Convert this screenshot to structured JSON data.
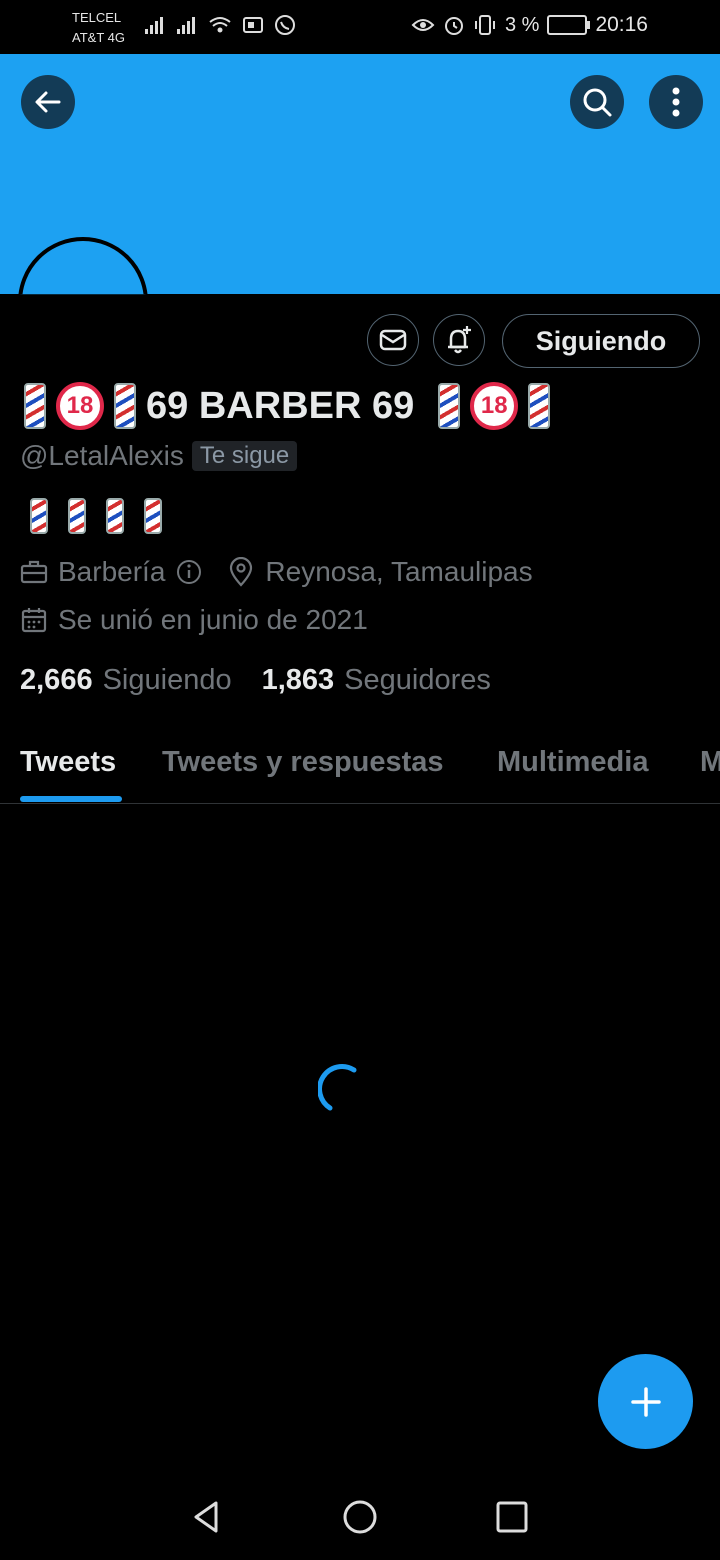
{
  "status_bar": {
    "carrier_1": "TELCEL",
    "carrier_2": "AT&T 4G",
    "battery": "3 %",
    "time": "20:16",
    "icons": [
      "signal-icon",
      "signal-icon",
      "wifi-icon",
      "data-icon",
      "whatsapp-icon",
      "eye-icon",
      "alarm-icon",
      "vibrate-icon",
      "battery-icon"
    ]
  },
  "header": {
    "back_icon": "back-arrow-icon",
    "search_icon": "search-icon",
    "more_icon": "more-vertical-icon",
    "banner_color": "#1da1f2"
  },
  "actions": {
    "message_icon": "mail-icon",
    "notify_icon": "bell-plus-icon",
    "following_label": "Siguiendo"
  },
  "profile": {
    "display_name": "69 BARBER 69",
    "handle": "@LetalAlexis",
    "follows_you": "Te sigue",
    "category": "Barbería",
    "location": "Reynosa, Tamaulipas",
    "joined": "Se unió en junio de 2021",
    "following_count": "2,666",
    "following_label": "Siguiendo",
    "followers_count": "1,863",
    "followers_label": "Seguidores"
  },
  "tabs": [
    {
      "label": "Tweets",
      "active": true
    },
    {
      "label": "Tweets y respuestas",
      "active": false
    },
    {
      "label": "Multimedia",
      "active": false
    },
    {
      "label": "M",
      "active": false
    }
  ],
  "fab_icon": "plus-icon",
  "nav": [
    "back-triangle-icon",
    "home-circle-icon",
    "recents-square-icon"
  ],
  "accent_color": "#1d9bf0"
}
